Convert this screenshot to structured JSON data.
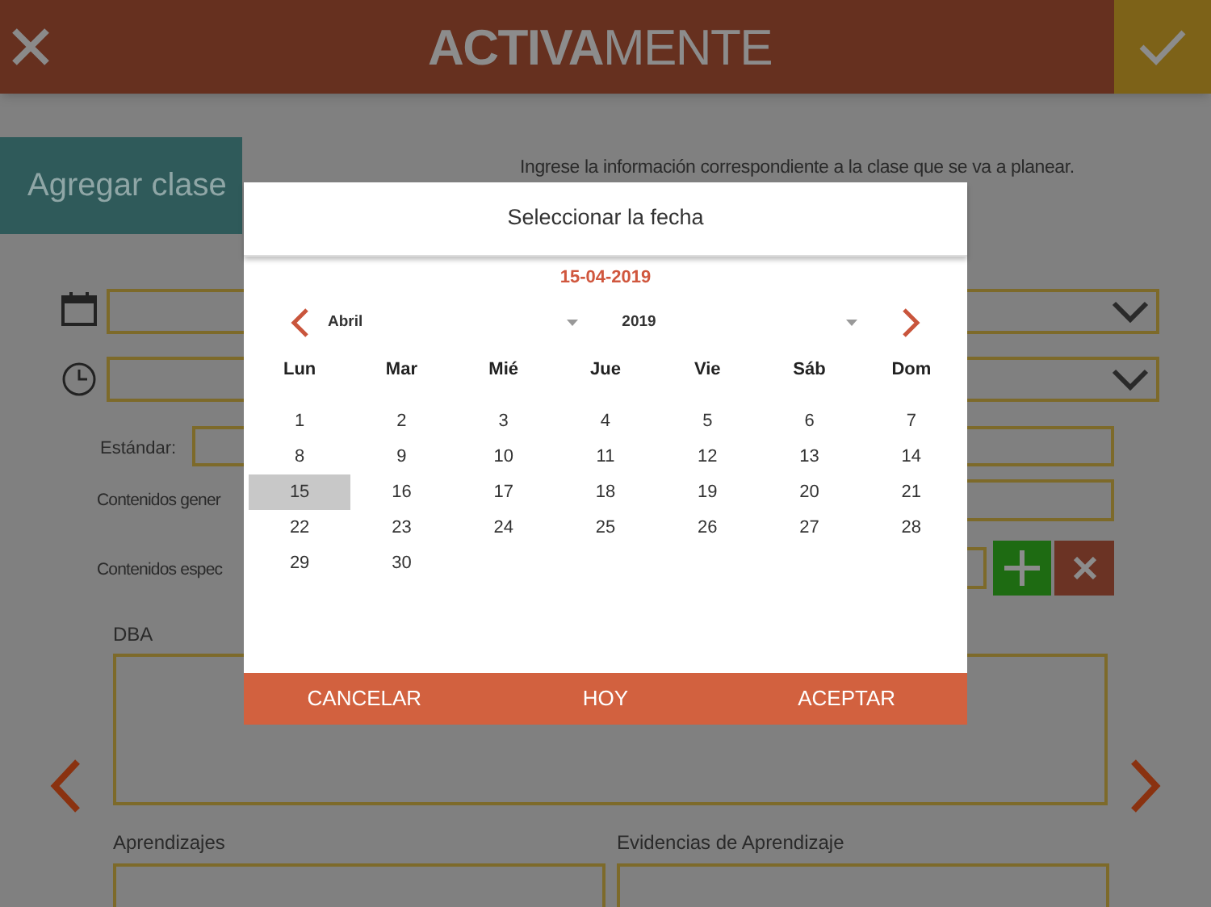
{
  "header": {
    "logo_bold": "ACTIVA",
    "logo_light": "MENTE"
  },
  "page": {
    "tab": "Agregar clase",
    "instruction": "Ingrese la información correspondiente a la clase que se va a planear.",
    "labels": [
      {
        "kind": "standard",
        "text": "Estándar:"
      },
      {
        "kind": "general",
        "text": "Contenidos gener"
      },
      {
        "kind": "specific",
        "text": "Contenidos espec"
      }
    ],
    "dba": "DBA",
    "learning": "Aprendizajes",
    "evidence": "Evidencias de Aprendizaje"
  },
  "dialog": {
    "title": "Seleccionar la fecha",
    "date": "15-04-2019",
    "month": "Abril",
    "year": "2019",
    "weekdays": [
      "Lun",
      "Mar",
      "Mié",
      "Jue",
      "Vie",
      "Sáb",
      "Dom"
    ],
    "days": [
      {
        "day": "1",
        "selected": false
      },
      {
        "day": "2",
        "selected": false
      },
      {
        "day": "3",
        "selected": false
      },
      {
        "day": "4",
        "selected": false
      },
      {
        "day": "5",
        "selected": false
      },
      {
        "day": "6",
        "selected": false
      },
      {
        "day": "7",
        "selected": false
      },
      {
        "day": "8",
        "selected": false
      },
      {
        "day": "9",
        "selected": false
      },
      {
        "day": "10",
        "selected": false
      },
      {
        "day": "11",
        "selected": false
      },
      {
        "day": "12",
        "selected": false
      },
      {
        "day": "13",
        "selected": false
      },
      {
        "day": "14",
        "selected": false
      },
      {
        "day": "15",
        "selected": true
      },
      {
        "day": "16",
        "selected": false
      },
      {
        "day": "17",
        "selected": false
      },
      {
        "day": "18",
        "selected": false
      },
      {
        "day": "19",
        "selected": false
      },
      {
        "day": "20",
        "selected": false
      },
      {
        "day": "21",
        "selected": false
      },
      {
        "day": "22",
        "selected": false
      },
      {
        "day": "23",
        "selected": false
      },
      {
        "day": "24",
        "selected": false
      },
      {
        "day": "25",
        "selected": false
      },
      {
        "day": "26",
        "selected": false
      },
      {
        "day": "27",
        "selected": false
      },
      {
        "day": "28",
        "selected": false
      },
      {
        "day": "29",
        "selected": false
      },
      {
        "day": "30",
        "selected": false
      }
    ],
    "buttons": [
      "CANCELAR",
      "HOY",
      "ACEPTAR"
    ]
  }
}
